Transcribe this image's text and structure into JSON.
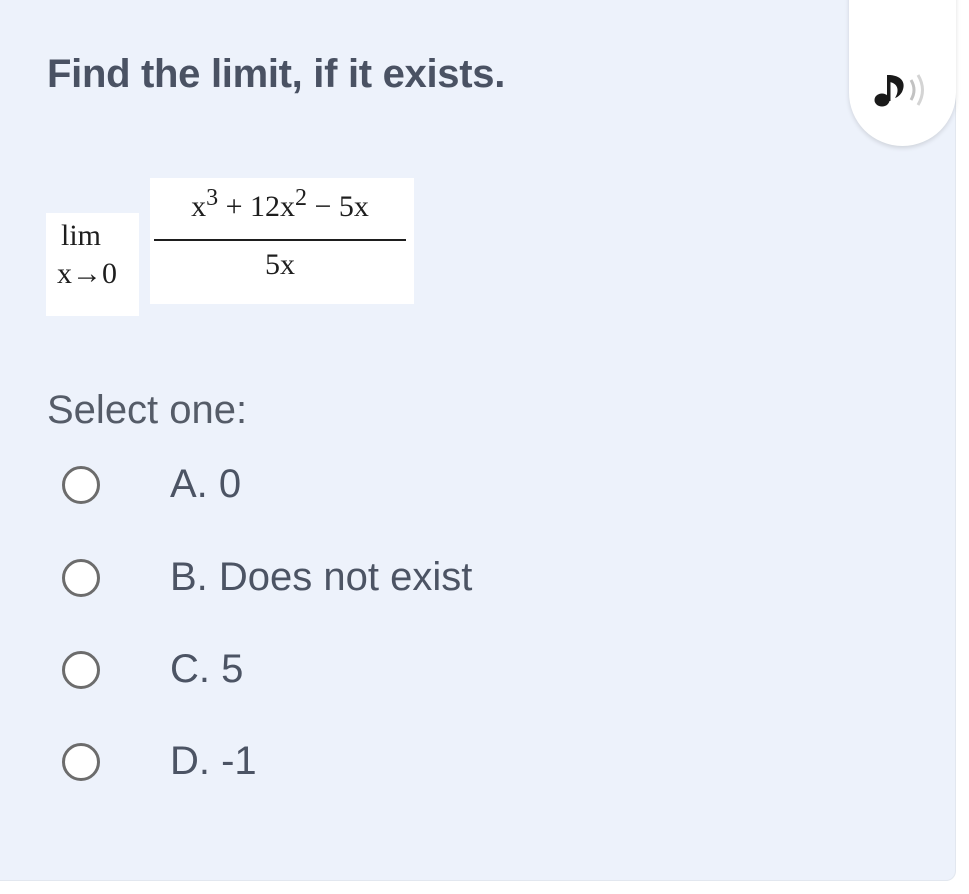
{
  "question": {
    "title": "Find the limit, if it exists.",
    "audio_icon": "speaker-note-icon",
    "limit": {
      "operator": "lim",
      "approach": "x→0",
      "numerator": {
        "term1_base": "x",
        "term1_exp": "3",
        "op1": " + 12x",
        "term2_exp": "2",
        "op2": " − 5x"
      },
      "denominator": "5x"
    }
  },
  "answer": {
    "prompt": "Select one:",
    "options": [
      {
        "label": "A. 0"
      },
      {
        "label": "B. Does not exist"
      },
      {
        "label": "C. 5"
      },
      {
        "label": "D. -1"
      }
    ]
  },
  "colors": {
    "card_background": "#edf2fb",
    "title_text": "#4a5263",
    "option_text": "#4c5464",
    "radio_border": "#6c6c6c"
  }
}
